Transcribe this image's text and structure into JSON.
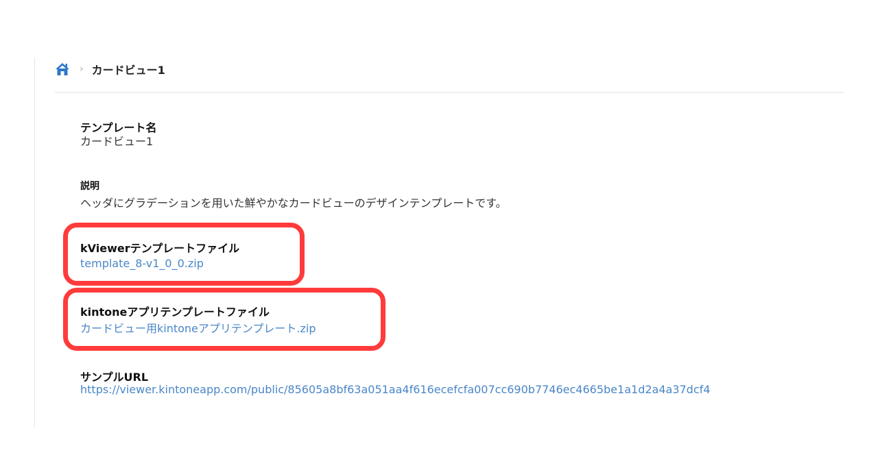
{
  "breadcrumb": {
    "home_icon": "home-icon",
    "separator": "›",
    "current": "カードビュー1"
  },
  "fields": {
    "template_name": {
      "label": "テンプレート名",
      "value": "カードビュー1"
    },
    "description": {
      "label": "説明",
      "value": "ヘッダにグラデーションを用いた鮮やかなカードビューのデザインテンプレートです。"
    },
    "kviewer_file": {
      "label": "kViewerテンプレートファイル",
      "link": "template_8-v1_0_0.zip"
    },
    "kintone_file": {
      "label": "kintoneアプリテンプレートファイル",
      "link": "カードビュー用kintoneアプリテンプレート.zip"
    },
    "sample_url": {
      "label": "サンプルURL",
      "link": "https://viewer.kintoneapp.com/public/85605a8bf63a051aa4f616ecefcfa007cc690b7746ec4665be1a1d2a4a37dcf4"
    }
  },
  "colors": {
    "link": "#4a86c8",
    "home_icon": "#2f77c9",
    "highlight": "#ff3b3b"
  }
}
